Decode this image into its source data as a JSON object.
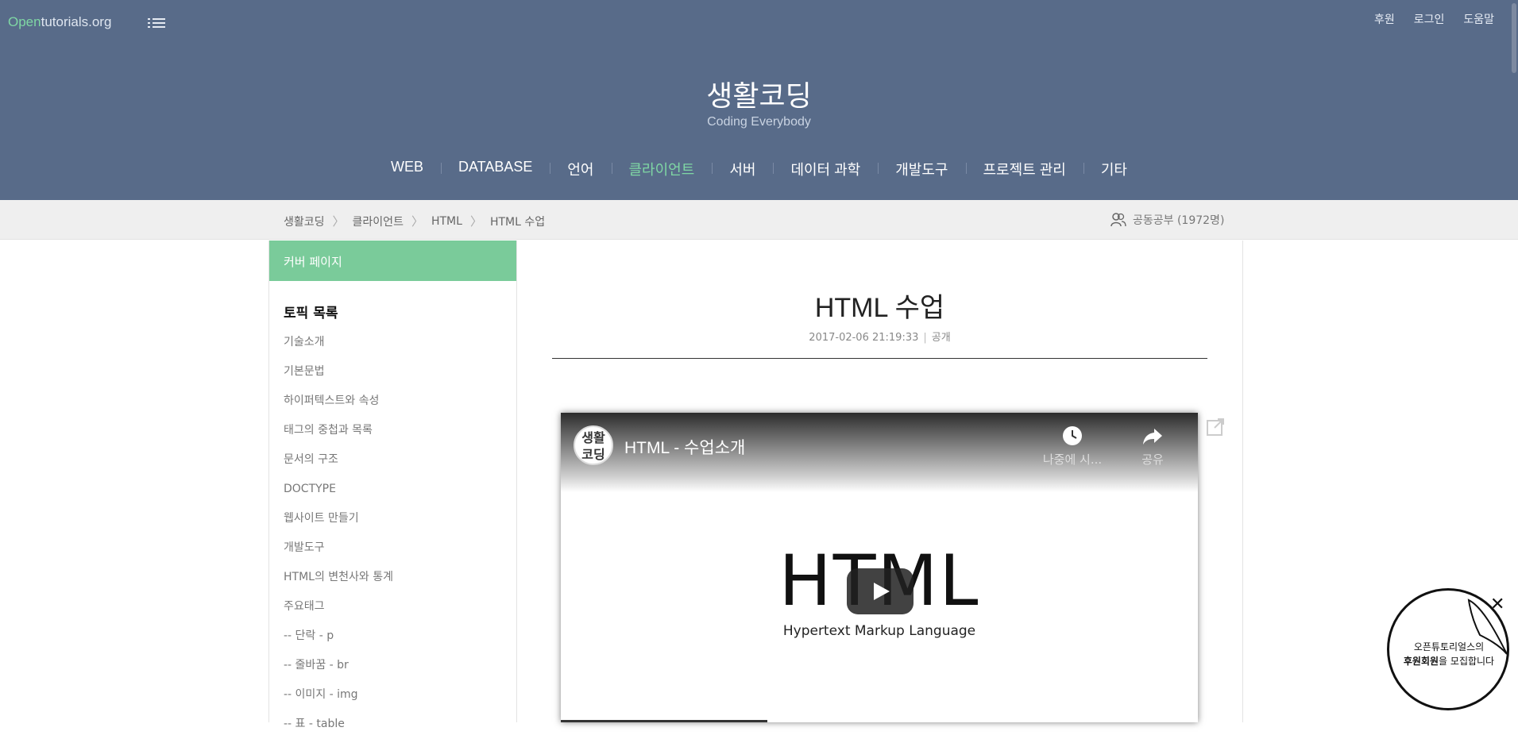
{
  "header": {
    "brand_open": "Open",
    "brand_rest": "tutorials.org",
    "top_links": [
      "후원",
      "로그인",
      "도움말"
    ],
    "site_title": "생활코딩",
    "site_subtitle": "Coding Everybody",
    "nav": [
      "WEB",
      "DATABASE",
      "언어",
      "클라이언트",
      "서버",
      "데이터 과학",
      "개발도구",
      "프로젝트 관리",
      "기타"
    ],
    "active_nav": "클라이언트"
  },
  "breadcrumb": [
    "생활코딩",
    "클라이언트",
    "HTML",
    "HTML 수업"
  ],
  "study": "공동공부 (1972명)",
  "sidebar": {
    "cover": "커버 페이지",
    "topic_heading": "토픽 목록",
    "topics": [
      "기술소개",
      "기본문법",
      "하이퍼텍스트와 속성",
      "태그의 중첩과 목록",
      "문서의 구조",
      "DOCTYPE",
      "웹사이트 만들기",
      "개발도구",
      "HTML의 변천사와 통계",
      "주요태그",
      "-- 단락 - p",
      "-- 줄바꿈 - br",
      "-- 이미지 - img",
      "-- 표 - table"
    ]
  },
  "article": {
    "title": "HTML 수업",
    "date": "2017-02-06 21:19:33",
    "visibility": "공개"
  },
  "video": {
    "channel_badge": "생활\n코딩",
    "title": "HTML - 수업소개",
    "watch_later": "나중에 시...",
    "share": "공유",
    "big_text": "HTML",
    "small_text": "Hypertext Markup Language"
  },
  "promo": {
    "line1": "오픈튜토리얼스의",
    "line2_bold": "후원회원",
    "line2_rest": "을 모집합니다",
    "close": "✕"
  },
  "colors": {
    "header_bg": "#586b89",
    "accent_green": "#7fd7a4",
    "cover_green": "#7acb9a"
  }
}
